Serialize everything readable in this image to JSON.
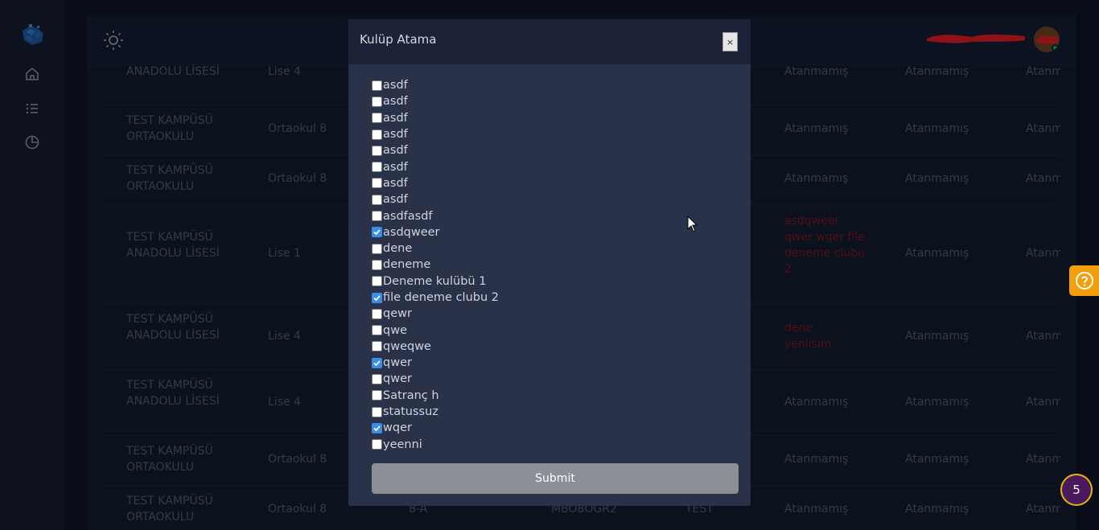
{
  "sidebar": {
    "icons": [
      "app-logo",
      "home-icon",
      "list-icon",
      "pie-chart-icon"
    ]
  },
  "header": {
    "theme_icon": "sun-icon",
    "badge_count": "5"
  },
  "table": {
    "rows": [
      {
        "school": "ANADOLU LİSESİ",
        "level": "Lise 4",
        "class": "",
        "code": "",
        "test": "",
        "c6": "Atanmamış",
        "c7": "Atanmamış",
        "c8": "Atanmamış"
      },
      {
        "school": "TEST KAMPÜSÜ ORTAOKULU",
        "level": "Ortaokul 8",
        "class": "",
        "code": "",
        "test": "",
        "c6": "Atanmamış",
        "c7": "Atanmamış",
        "c8": "Atanmamış"
      },
      {
        "school": "TEST KAMPÜSÜ ORTAOKULU",
        "level": "Ortaokul 8",
        "class": "",
        "code": "",
        "test": "",
        "c6": "Atanmamış",
        "c7": "Atanmamış",
        "c8": "Atanmamış"
      },
      {
        "school": "TEST KAMPÜSÜ ANADOLU LİSESİ",
        "level": "Lise 1",
        "class": "",
        "code": "",
        "test": "",
        "c6": "asdqweer qwer wqer file deneme clubu 2",
        "c7": "Atanmamış",
        "c8": "Atanmamış"
      },
      {
        "school": "TEST KAMPÜSÜ ANADOLU LİSESİ",
        "level": "Lise 4",
        "class": "",
        "code": "",
        "test": "",
        "c6": "dene yenlisim",
        "c7": "Atanmamış",
        "c8": "Atanmamış"
      },
      {
        "school": "TEST KAMPÜSÜ ANADOLU LİSESİ",
        "level": "Lise 4",
        "class": "",
        "code": "",
        "test": "",
        "c6": "Atanmamış",
        "c7": "Atanmamış",
        "c8": "Atanmamış"
      },
      {
        "school": "TEST KAMPÜSÜ ORTAOKULU",
        "level": "Ortaokul 8",
        "class": "",
        "code": "",
        "test": "",
        "c6": "Atanmamış",
        "c7": "Atanmamış",
        "c8": "Atanmamış"
      },
      {
        "school": "TEST KAMPÜSÜ ORTAOKULU",
        "level": "Ortaokul 8",
        "class": "8-A",
        "code": "MBO8OGR2",
        "test": "TEST",
        "c6": "Atanmamış",
        "c7": "Atanmamış",
        "c8": "Atanmamış"
      }
    ]
  },
  "modal": {
    "title": "Kulüp Atama",
    "close_label": "×",
    "submit_label": "Submit",
    "options": [
      {
        "label": "asdf",
        "checked": false
      },
      {
        "label": "asdf",
        "checked": false
      },
      {
        "label": "asdf",
        "checked": false
      },
      {
        "label": "asdf",
        "checked": false
      },
      {
        "label": "asdf",
        "checked": false
      },
      {
        "label": "asdf",
        "checked": false
      },
      {
        "label": "asdf",
        "checked": false
      },
      {
        "label": "asdf",
        "checked": false
      },
      {
        "label": "asdfasdf",
        "checked": false
      },
      {
        "label": "asdqweer",
        "checked": true
      },
      {
        "label": "dene",
        "checked": false
      },
      {
        "label": "deneme",
        "checked": false
      },
      {
        "label": "Deneme kulübü 1",
        "checked": false
      },
      {
        "label": "file deneme clubu 2",
        "checked": true
      },
      {
        "label": "qewr",
        "checked": false
      },
      {
        "label": "qwe",
        "checked": false
      },
      {
        "label": "qweqwe",
        "checked": false
      },
      {
        "label": "qwer",
        "checked": true
      },
      {
        "label": "qwer",
        "checked": false
      },
      {
        "label": "Satranç h",
        "checked": false
      },
      {
        "label": "statussuz",
        "checked": false
      },
      {
        "label": "wqer",
        "checked": true
      },
      {
        "label": "yeenni",
        "checked": false
      }
    ]
  },
  "colors": {
    "accent": "#3b8ee6",
    "unassigned_red": "#8b1518",
    "help_button": "#f59e0b"
  }
}
